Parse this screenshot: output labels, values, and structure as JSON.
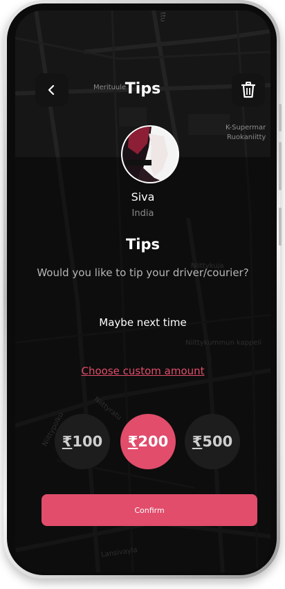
{
  "header": {
    "title": "Tips",
    "back_icon": "chevron-left-icon",
    "delete_icon": "trash-icon"
  },
  "map": {
    "labels": [
      "Merituule",
      "K-Supermar",
      "Ruokaniitty",
      "Niittykuja",
      "Niittykummun kappeli",
      "Niittyratu",
      "Niittypolku",
      "Lansivayla",
      "ttu"
    ]
  },
  "profile": {
    "name": "Siva",
    "country": "India",
    "avatar_icon": "avatar-image"
  },
  "content": {
    "heading": "Tips",
    "question": "Would you like to tip your driver/courier?",
    "skip_label": "Maybe next time",
    "custom_amount_label": "Choose custom amount"
  },
  "amounts": [
    {
      "currency": "₹",
      "value": "100",
      "selected": false
    },
    {
      "currency": "₹",
      "value": "200",
      "selected": true
    },
    {
      "currency": "₹",
      "value": "500",
      "selected": false
    }
  ],
  "confirm_label": "Confirm",
  "colors": {
    "accent": "#e14d6b",
    "background": "#141414",
    "text": "#ffffff",
    "muted": "#8a8a8a"
  }
}
